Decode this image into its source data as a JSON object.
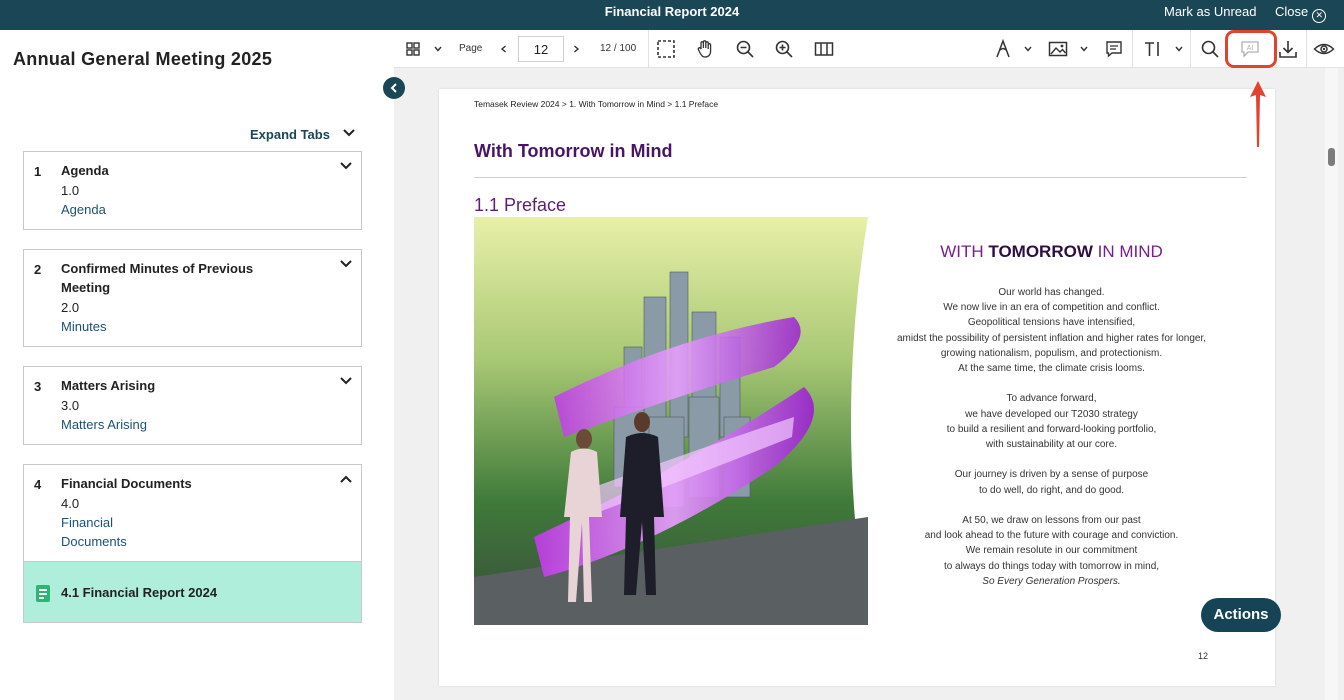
{
  "topbar": {
    "title": "Financial Report 2024",
    "mark_unread": "Mark as Unread",
    "close": "Close",
    "bg_color": "#1a4655"
  },
  "sidebar": {
    "meeting_title": "Annual General Meeting 2025",
    "expand_tabs": "Expand Tabs",
    "items": [
      {
        "num": "1",
        "title": "Agenda",
        "code": "1.0",
        "link": "Agenda",
        "expanded": false
      },
      {
        "num": "2",
        "title": "Confirmed Minutes of Previous Meeting",
        "code": "2.0",
        "link": "Minutes",
        "expanded": false
      },
      {
        "num": "3",
        "title": "Matters Arising",
        "code": "3.0",
        "link": "Matters Arising",
        "expanded": false
      },
      {
        "num": "4",
        "title": "Financial Documents",
        "code": "4.0",
        "link": "Financial Documents",
        "expanded": true
      }
    ],
    "active_subitem": "4.1 Financial Report 2024",
    "active_color": "#aeeedb"
  },
  "toolbar": {
    "page_label": "Page",
    "page_value": "12",
    "page_count": "12 / 100",
    "icons": [
      "grid-icon",
      "select-area-icon",
      "hand-icon",
      "zoom-out-icon",
      "zoom-in-icon",
      "two-page-icon",
      "pen-icon",
      "image-icon",
      "comment-icon",
      "text-tool-icon",
      "search-icon",
      "ai-icon",
      "download-icon",
      "eye-icon"
    ],
    "highlight_color": "#e0442f"
  },
  "document": {
    "breadcrumb": "Temasek Review 2024 > 1. With Tomorrow in Mind > 1.1 Preface",
    "heading": "With Tomorrow in Mind",
    "subheading": "1.1 Preface",
    "headline_pre": "WITH ",
    "headline_bold": "TOMORROW",
    "headline_post": " IN MIND",
    "paragraphs": [
      [
        "Our world has changed.",
        "We now live in an era of competition and conflict.",
        "Geopolitical tensions have intensified,",
        "amidst the possibility of persistent inflation and higher rates for longer,",
        "growing nationalism, populism, and protectionism.",
        "At the same time, the climate crisis looms."
      ],
      [
        "To advance forward,",
        "we have developed our T2030 strategy",
        "to build a resilient and forward-looking portfolio,",
        "with sustainability at our core."
      ],
      [
        "Our journey is driven by a sense of purpose",
        "to do well, do right, and do good."
      ],
      [
        "At 50, we draw on lessons from our past",
        "and look ahead to the future with courage and conviction.",
        "We remain resolute in our commitment",
        "to always do things today with tomorrow in mind,"
      ]
    ],
    "closing": "So Every Generation Prospers.",
    "page_number": "12"
  },
  "actions_label": "Actions"
}
